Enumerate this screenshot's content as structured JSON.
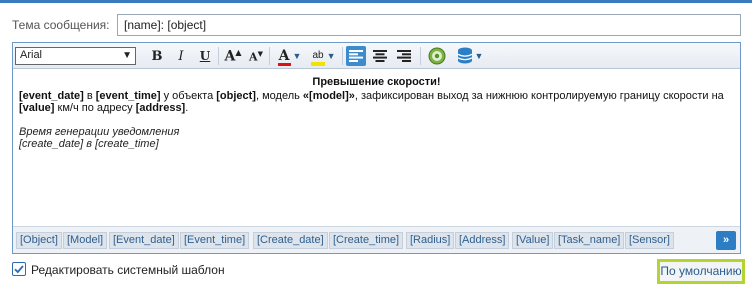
{
  "subject": {
    "label": "Тема сообщения:",
    "value": "[name]: [object]"
  },
  "toolbar": {
    "font_value": "Arial",
    "bold": "B",
    "italic": "I",
    "underline": "U",
    "grow": "A",
    "shrink": "A",
    "font_color": "A",
    "highlight": "ab",
    "icons": [
      "dropdown-icon",
      "bold-icon",
      "italic-icon",
      "underline-icon",
      "font-grow-icon",
      "font-shrink-icon",
      "font-color-icon",
      "highlight-icon",
      "align-left-icon",
      "align-center-icon",
      "align-right-icon",
      "insert-image-icon",
      "insert-variable-icon"
    ]
  },
  "content": {
    "heading": "Превышение скорости!",
    "line1_b1": "[event_date]",
    "line1_t1": " в ",
    "line1_b2": "[event_time]",
    "line1_t2": " у объекта ",
    "line1_b3": "[object]",
    "line1_t3": ", модель ",
    "line1_b4": "«[model]»",
    "line1_t4": ", зафиксирован выход за нижнюю контролируемую границу скорости на ",
    "line1_b5": "[value]",
    "line1_t5": " км/ч по адресу ",
    "line1_b6": "[address]",
    "line1_t6": ".",
    "footer1": "Время генерации уведомления",
    "footer2": "[create_date] в [create_time]"
  },
  "tags": [
    "[Object]",
    "[Model]",
    "[Event_date]",
    "[Event_time]",
    "[Create_date]",
    "[Create_time]",
    "[Radius]",
    "[Address]",
    "[Value]",
    "[Task_name]",
    "[Sensor]"
  ],
  "more_label": "»",
  "checkbox": {
    "label": "Редактировать системный шаблон",
    "checked": true
  },
  "default_button": "По умолчанию",
  "colors": {
    "accent": "#3a8ccf",
    "default_button_border": "#b4d432",
    "tag_text": "#2f5f8f"
  }
}
